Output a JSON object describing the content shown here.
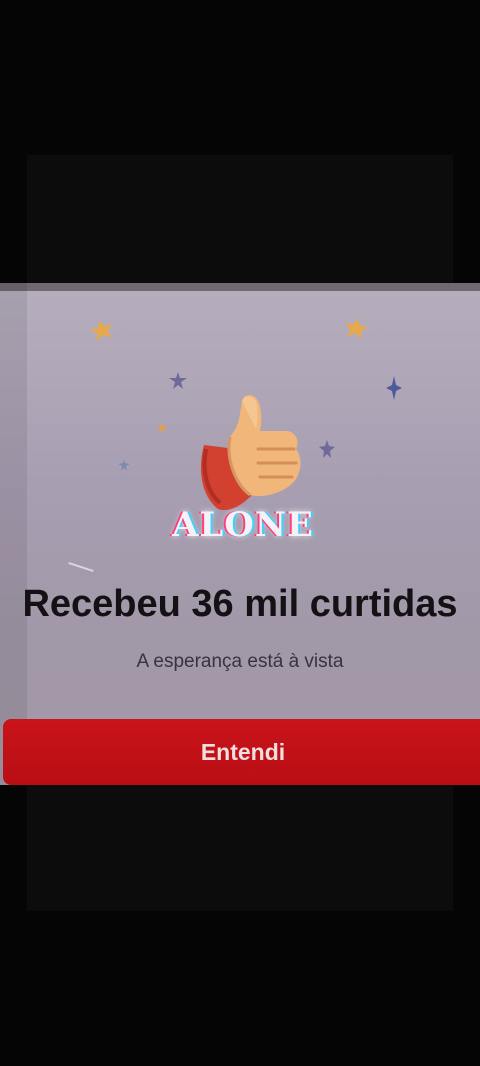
{
  "dialog": {
    "title": "Recebeu 36 mil curtidas",
    "subtitle": "A esperança está à vista",
    "button_label": "Entendi",
    "watermark_text": "ALONE"
  },
  "icons": {
    "illustration": "thumbs-up-icon",
    "decoration": "star-icon"
  },
  "colors": {
    "card_background": "#a89eb2",
    "button": "#c9131a",
    "title_text": "#141014",
    "star_gold": "#e8a94a",
    "star_purple": "#6f6a9a"
  }
}
